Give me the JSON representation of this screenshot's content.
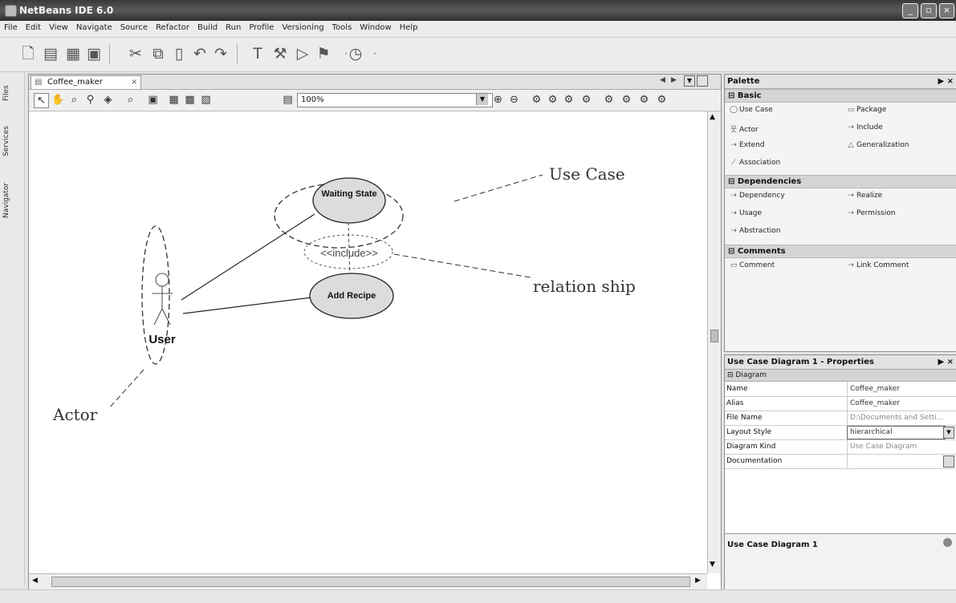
{
  "window": {
    "title": "NetBeans IDE 6.0"
  },
  "menu": [
    "File",
    "Edit",
    "View",
    "Navigate",
    "Source",
    "Refactor",
    "Build",
    "Run",
    "Profile",
    "Versioning",
    "Tools",
    "Window",
    "Help"
  ],
  "side_tabs": [
    "Files",
    "Services",
    "Navigator"
  ],
  "editor": {
    "tab_label": "Coffee_maker",
    "zoom": "100%",
    "diagram": {
      "use_case_1": "Waiting State",
      "use_case_2": "Add Recipe",
      "relation": "<<include>>",
      "actor": "User"
    },
    "annotations": {
      "use_case": "Use Case",
      "relationship": "relation ship",
      "actor": "Actor"
    }
  },
  "palette": {
    "title": "Palette",
    "categories": [
      {
        "name": "Basic",
        "items": [
          "Use Case",
          "Package",
          "Actor",
          "Include",
          "Extend",
          "Generalization",
          "Association"
        ]
      },
      {
        "name": "Dependencies",
        "items": [
          "Dependency",
          "Realize",
          "Usage",
          "Permission",
          "Abstraction"
        ]
      },
      {
        "name": "Comments",
        "items": [
          "Comment",
          "Link Comment"
        ]
      }
    ]
  },
  "properties": {
    "title": "Use Case Diagram 1 - Properties",
    "section": "Diagram",
    "rows": [
      {
        "key": "Name",
        "value": "Coffee_maker"
      },
      {
        "key": "Alias",
        "value": "Coffee_maker"
      },
      {
        "key": "File Name",
        "value": "D:\\Documents and Setti..."
      },
      {
        "key": "Layout Style",
        "value": "hierarchical"
      },
      {
        "key": "Diagram Kind",
        "value": "Use Case Diagram"
      },
      {
        "key": "Documentation",
        "value": ""
      }
    ],
    "footer": "Use Case Diagram 1"
  }
}
